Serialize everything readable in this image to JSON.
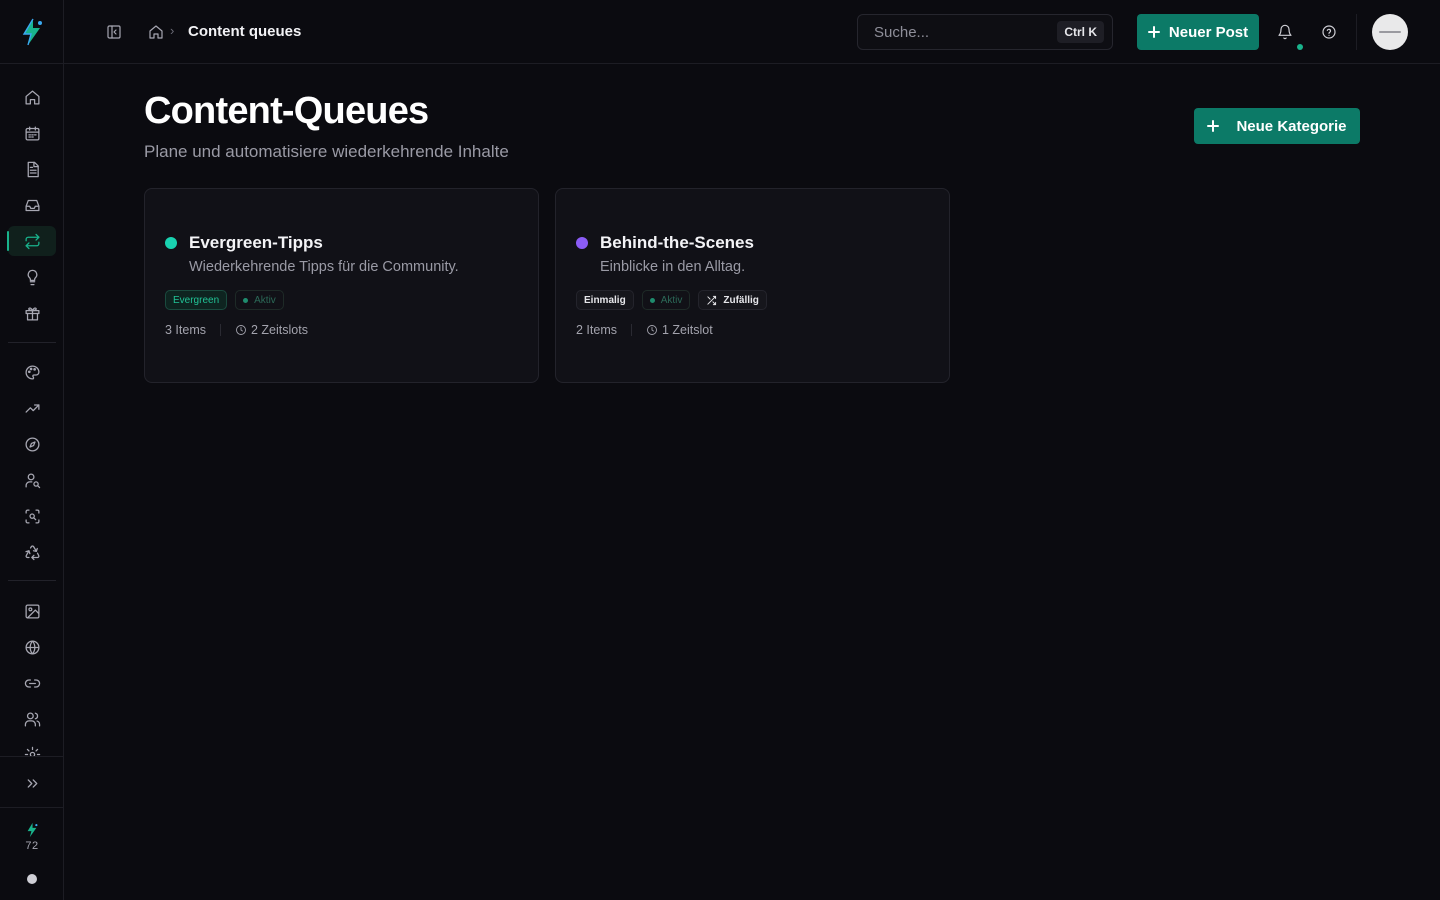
{
  "app": {
    "brand_color": "#19b38c",
    "accent_button": "#0c7a67"
  },
  "sidebar": {
    "items": [
      {
        "id": "home",
        "icon": "home-icon",
        "active": false
      },
      {
        "id": "calendar",
        "icon": "calendar-icon",
        "active": false
      },
      {
        "id": "posts",
        "icon": "document-icon",
        "active": false
      },
      {
        "id": "inbox",
        "icon": "inbox-icon",
        "active": false
      },
      {
        "id": "queues",
        "icon": "repeat-icon",
        "active": true
      },
      {
        "id": "ideas",
        "icon": "lightbulb-icon",
        "active": false
      },
      {
        "id": "gifts",
        "icon": "gift-icon",
        "active": false
      },
      {
        "id": "brand",
        "icon": "palette-icon",
        "active": false
      },
      {
        "id": "analytics",
        "icon": "trending-up-icon",
        "active": false
      },
      {
        "id": "explore",
        "icon": "compass-icon",
        "active": false
      },
      {
        "id": "user-search",
        "icon": "user-search-icon",
        "active": false
      },
      {
        "id": "scan",
        "icon": "scan-icon",
        "active": false
      },
      {
        "id": "recycle",
        "icon": "recycle-icon",
        "active": false
      },
      {
        "id": "media",
        "icon": "image-icon",
        "active": false
      },
      {
        "id": "web",
        "icon": "globe-icon",
        "active": false
      },
      {
        "id": "links",
        "icon": "link-icon",
        "active": false
      },
      {
        "id": "team",
        "icon": "users-icon",
        "active": false
      },
      {
        "id": "settings",
        "icon": "gear-icon",
        "active": false
      }
    ],
    "credits": "72"
  },
  "header": {
    "breadcrumb_current": "Content queues",
    "search_placeholder": "Suche...",
    "search_shortcut": "Ctrl K",
    "new_post_label": "Neuer Post"
  },
  "main": {
    "title": "Content-Queues",
    "subtitle": "Plane und automatisiere wiederkehrende Inhalte",
    "new_category_label": "Neue Kategorie",
    "cards": [
      {
        "title": "Evergreen-Tipps",
        "description": "Wiederkehrende Tipps für die Community.",
        "dot_color": "#19d2b0",
        "badge_type": "Evergreen",
        "badge_status": "Aktiv",
        "items": "3 Items",
        "slots": "2 Zeitslots"
      },
      {
        "title": "Behind-the-Scenes",
        "description": "Einblicke in den Alltag.",
        "dot_color": "#8b5cf6",
        "badge_type": "Einmalig",
        "badge_status": "Aktiv",
        "badge_order": "Zufällig",
        "items": "2 Items",
        "slots": "1 Zeitslot"
      }
    ]
  }
}
